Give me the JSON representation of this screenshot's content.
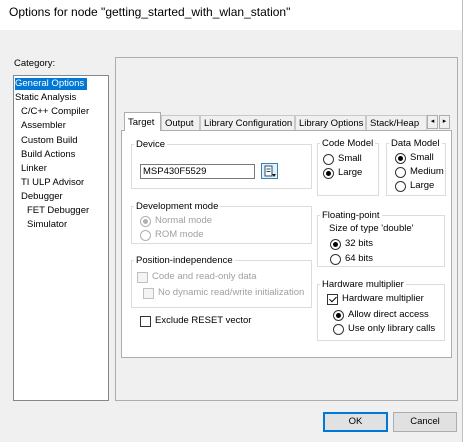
{
  "window": {
    "title": "Options for node \"getting_started_with_wlan_station\""
  },
  "category": {
    "label": "Category:",
    "items": [
      {
        "label": "General Options",
        "selected": true
      },
      {
        "label": "Static Analysis"
      },
      {
        "label": "C/C++ Compiler"
      },
      {
        "label": "Assembler"
      },
      {
        "label": "Custom Build"
      },
      {
        "label": "Build Actions"
      },
      {
        "label": "Linker"
      },
      {
        "label": "TI ULP Advisor"
      },
      {
        "label": "Debugger"
      },
      {
        "label": "FET Debugger"
      },
      {
        "label": "Simulator"
      }
    ]
  },
  "tabs": [
    {
      "label": "Target",
      "active": true
    },
    {
      "label": "Output"
    },
    {
      "label": "Library Configuration"
    },
    {
      "label": "Library Options"
    },
    {
      "label": "Stack/Heap"
    }
  ],
  "tab_arrows": {
    "left": "◂",
    "right": "▸"
  },
  "device": {
    "group_label": "Device",
    "value": "MSP430F5529",
    "browse_icon": "device-browse-icon"
  },
  "code_model": {
    "group_label": "Code Model",
    "options": [
      "Small",
      "Large"
    ],
    "selected": "Large"
  },
  "data_model": {
    "group_label": "Data Model",
    "options": [
      "Small",
      "Medium",
      "Large"
    ],
    "selected": "Small"
  },
  "dev_mode": {
    "group_label": "Development mode",
    "options": [
      "Normal mode",
      "ROM mode"
    ],
    "selected": "Normal mode",
    "enabled": false
  },
  "pos_indep": {
    "group_label": "Position-independence",
    "code_ro": "Code and read-only data",
    "no_dyn": "No dynamic read/write initialization",
    "enabled": false
  },
  "floating_point": {
    "group_label": "Floating-point",
    "size_label": "Size of type 'double'",
    "options": [
      "32 bits",
      "64 bits"
    ],
    "selected": "32 bits"
  },
  "exclude_reset": {
    "label": "Exclude RESET vector",
    "checked": false
  },
  "hw_mult": {
    "group_label": "Hardware multiplier",
    "check_label": "Hardware multiplier",
    "checked": true,
    "options": [
      "Allow direct access",
      "Use only library calls"
    ],
    "selected": "Allow direct access"
  },
  "buttons": {
    "ok": "OK",
    "cancel": "Cancel"
  }
}
